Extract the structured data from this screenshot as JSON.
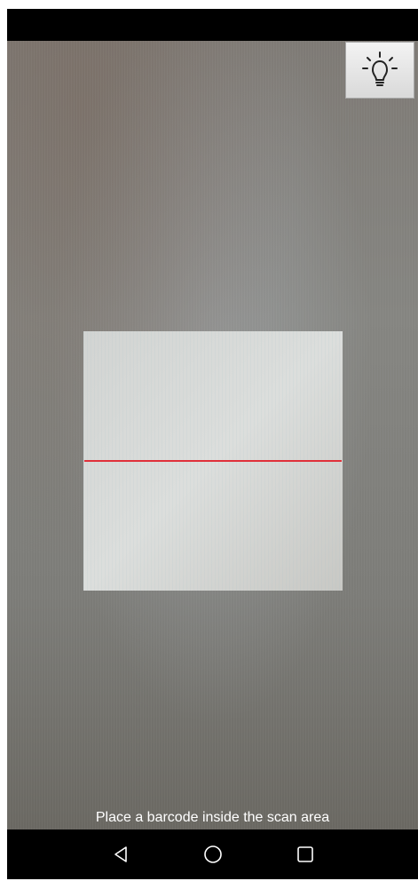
{
  "app": {
    "hint_text": "Place a barcode inside the scan area"
  },
  "toolbar": {
    "flashlight_icon": "lightbulb-icon"
  },
  "scanner": {
    "scan_line_color": "#e0303a"
  },
  "navigation": {
    "back_icon": "back-triangle-icon",
    "home_icon": "home-circle-icon",
    "recents_icon": "recents-square-icon"
  }
}
